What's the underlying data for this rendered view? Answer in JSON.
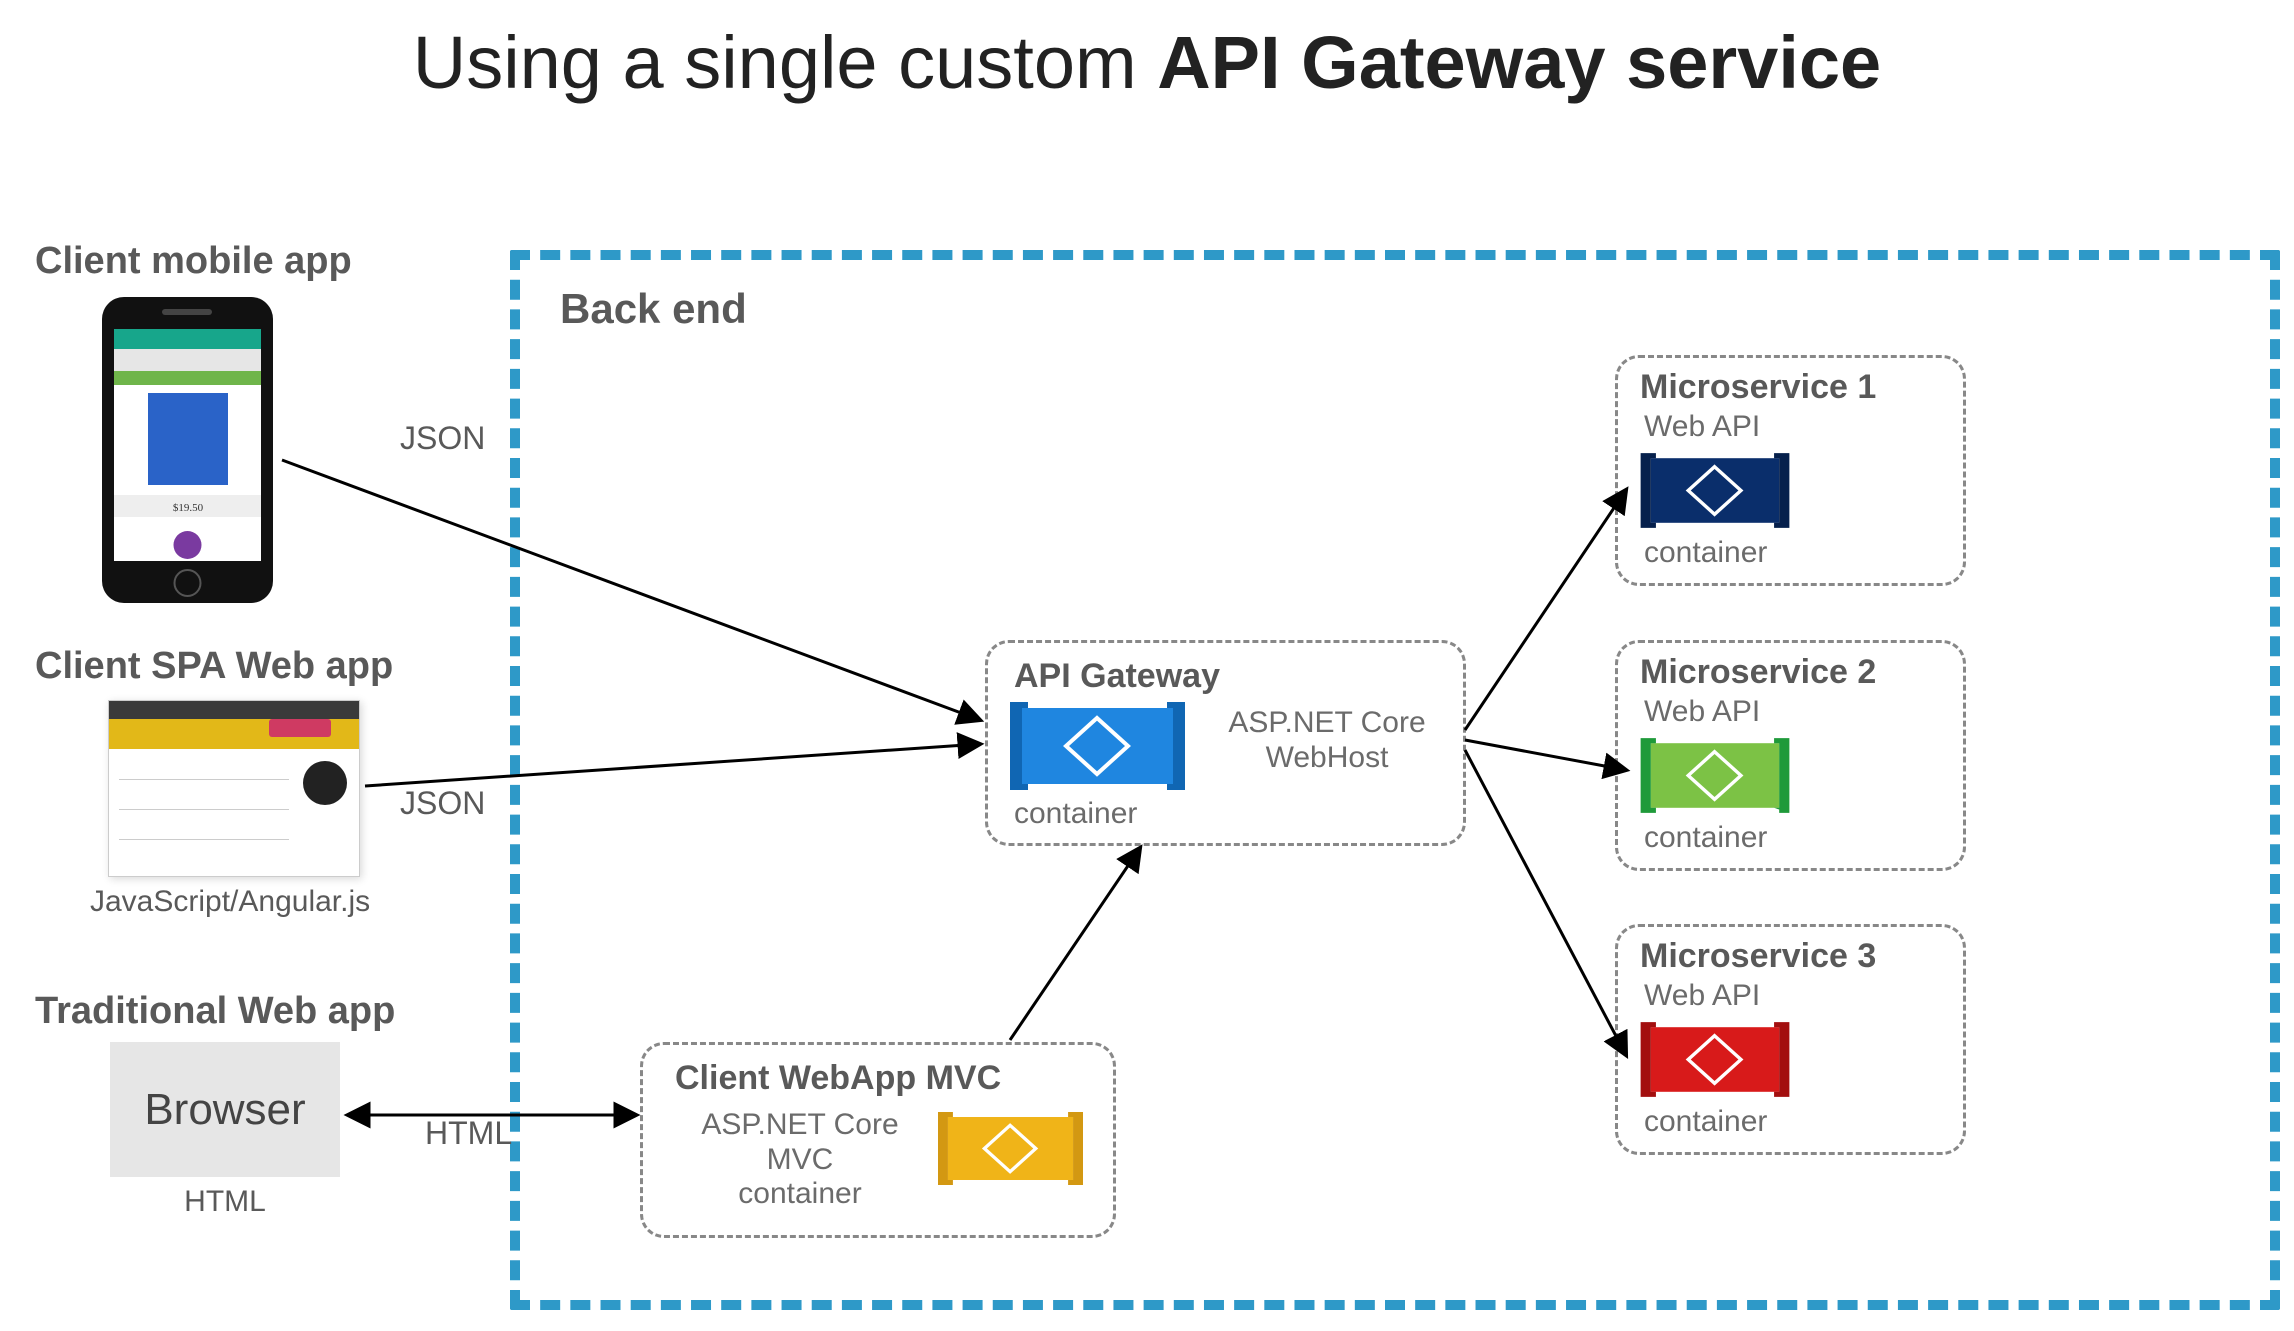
{
  "title_prefix": "Using a single custom ",
  "title_bold": "API Gateway service",
  "clients": {
    "mobile": {
      "heading": "Client mobile app"
    },
    "spa": {
      "heading": "Client SPA Web app",
      "caption": "JavaScript/Angular.js"
    },
    "traditional": {
      "heading": "Traditional Web app",
      "browser_label": "Browser",
      "caption": "HTML"
    }
  },
  "backend_label": "Back end",
  "gateway": {
    "title": "API Gateway",
    "subtitle1": "ASP.NET Core",
    "subtitle2": "WebHost",
    "container_label": "container"
  },
  "webapp": {
    "title": "Client WebApp MVC",
    "subtitle1": "ASP.NET Core MVC",
    "subtitle2": "container"
  },
  "microservices": [
    {
      "title": "Microservice 1",
      "subtitle": "Web API",
      "container_label": "container",
      "fill": "#0a2e6b",
      "stroke": "#0a2e6b"
    },
    {
      "title": "Microservice 2",
      "subtitle": "Web API",
      "container_label": "container",
      "fill": "#7cc245",
      "stroke": "#1f9a3a"
    },
    {
      "title": "Microservice 3",
      "subtitle": "Web API",
      "container_label": "container",
      "fill": "#d81a1a",
      "stroke": "#a30f0f"
    }
  ],
  "edge_labels": {
    "mobile_to_gateway": "JSON",
    "spa_to_gateway": "JSON",
    "browser_to_webapp": "HTML"
  },
  "icon_colors": {
    "gateway": {
      "fill": "#1f86e0",
      "stroke": "#1f86e0"
    },
    "webapp": {
      "fill": "#f0b418",
      "stroke": "#d39812"
    }
  }
}
